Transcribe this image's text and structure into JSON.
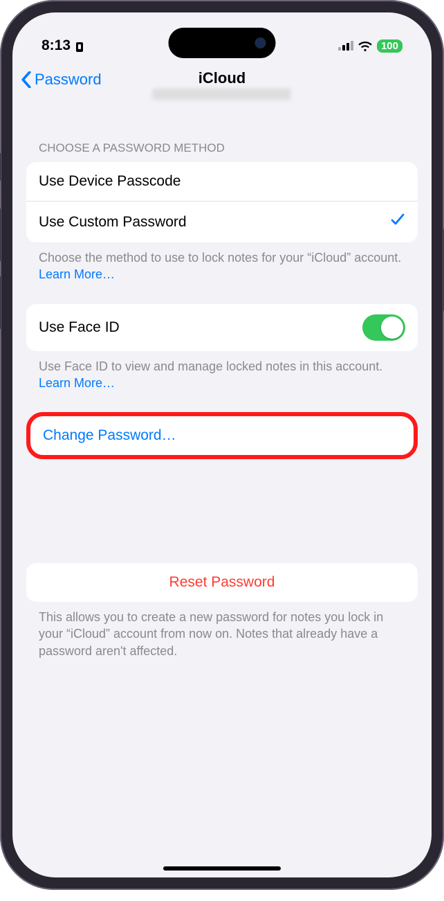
{
  "status": {
    "time": "8:13",
    "battery": "100"
  },
  "nav": {
    "back_label": "Password",
    "title": "iCloud"
  },
  "section1": {
    "header": "CHOOSE A PASSWORD METHOD",
    "option_passcode": "Use Device Passcode",
    "option_custom": "Use Custom Password",
    "footer_pre": "Choose the method to use to lock notes for your “iCloud” account. ",
    "learn_more": "Learn More…"
  },
  "section2": {
    "faceid_label": "Use Face ID",
    "footer_pre": "Use Face ID to view and manage locked notes in this account. ",
    "learn_more": "Learn More…"
  },
  "section3": {
    "change_password": "Change Password…"
  },
  "section4": {
    "reset_password": "Reset Password",
    "footer": "This allows you to create a new password for notes you lock in your “iCloud” account from now on. Notes that already have a password aren't affected."
  }
}
